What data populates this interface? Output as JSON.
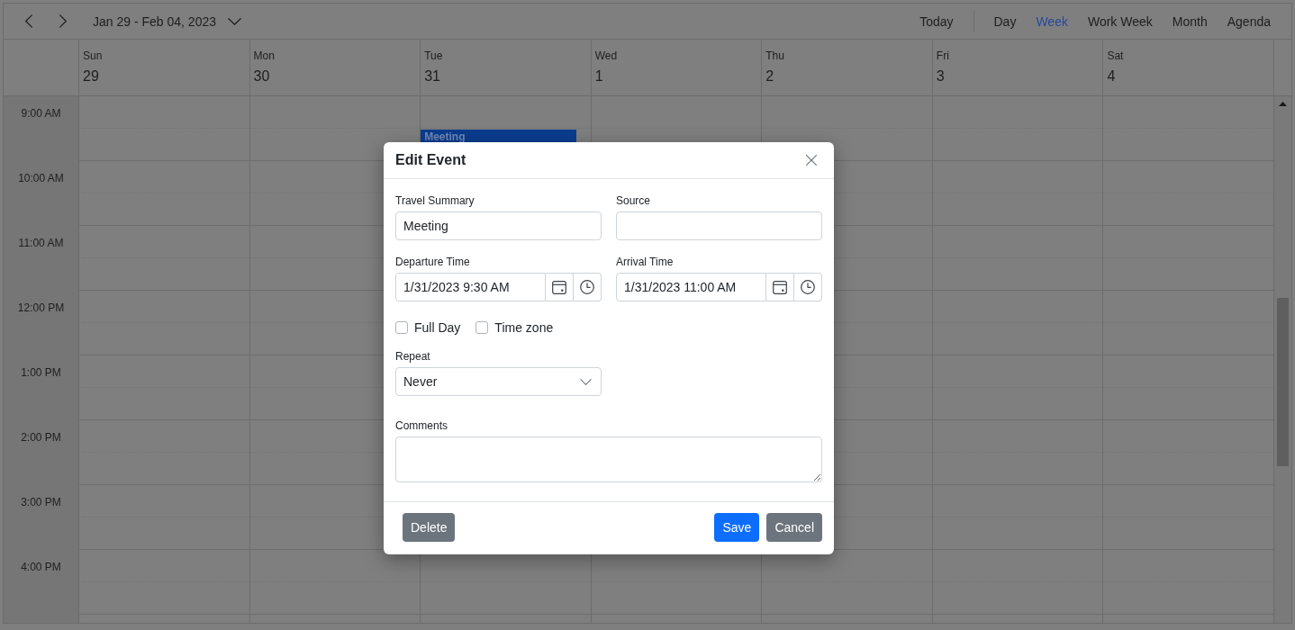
{
  "toolbar": {
    "date_range": "Jan 29 - Feb 04, 2023",
    "today": "Today",
    "views": [
      {
        "label": "Day",
        "selected": false
      },
      {
        "label": "Week",
        "selected": true
      },
      {
        "label": "Work Week",
        "selected": false
      },
      {
        "label": "Month",
        "selected": false
      },
      {
        "label": "Agenda",
        "selected": false
      }
    ]
  },
  "days": [
    {
      "name": "Sun",
      "date": "29"
    },
    {
      "name": "Mon",
      "date": "30"
    },
    {
      "name": "Tue",
      "date": "31",
      "events": [
        {
          "title": "Meeting"
        }
      ]
    },
    {
      "name": "Wed",
      "date": "1"
    },
    {
      "name": "Thu",
      "date": "2"
    },
    {
      "name": "Fri",
      "date": "3"
    },
    {
      "name": "Sat",
      "date": "4"
    }
  ],
  "time_slots": [
    "9:00 AM",
    "10:00 AM",
    "11:00 AM",
    "12:00 PM",
    "1:00 PM",
    "2:00 PM",
    "3:00 PM",
    "4:00 PM"
  ],
  "dialog": {
    "title": "Edit Event",
    "rows": [
      {
        "fields": [
          {
            "kind": "text",
            "label": "Travel Summary",
            "value": "Meeting"
          },
          {
            "kind": "text",
            "label": "Source"
          }
        ]
      },
      {
        "fields": [
          {
            "kind": "datetime",
            "label": "Departure Time",
            "value": "1/31/2023 9:30 AM"
          },
          {
            "kind": "datetime",
            "label": "Arrival Time",
            "value": "1/31/2023 11:00 AM"
          }
        ]
      },
      {
        "checkboxes": [
          {
            "label": "Full Day",
            "checked": false
          },
          {
            "label": "Time zone",
            "checked": false
          }
        ]
      },
      {
        "fields": [
          {
            "kind": "select",
            "label": "Repeat",
            "value": "Never"
          }
        ]
      },
      {
        "fields": [
          {
            "kind": "textarea",
            "label": "Comments"
          }
        ]
      }
    ],
    "footer": {
      "start": [
        {
          "label": "Delete",
          "kind": "secondary"
        }
      ],
      "end": [
        {
          "label": "Save",
          "kind": "primary"
        },
        {
          "label": "Cancel",
          "kind": "secondary"
        }
      ]
    }
  }
}
